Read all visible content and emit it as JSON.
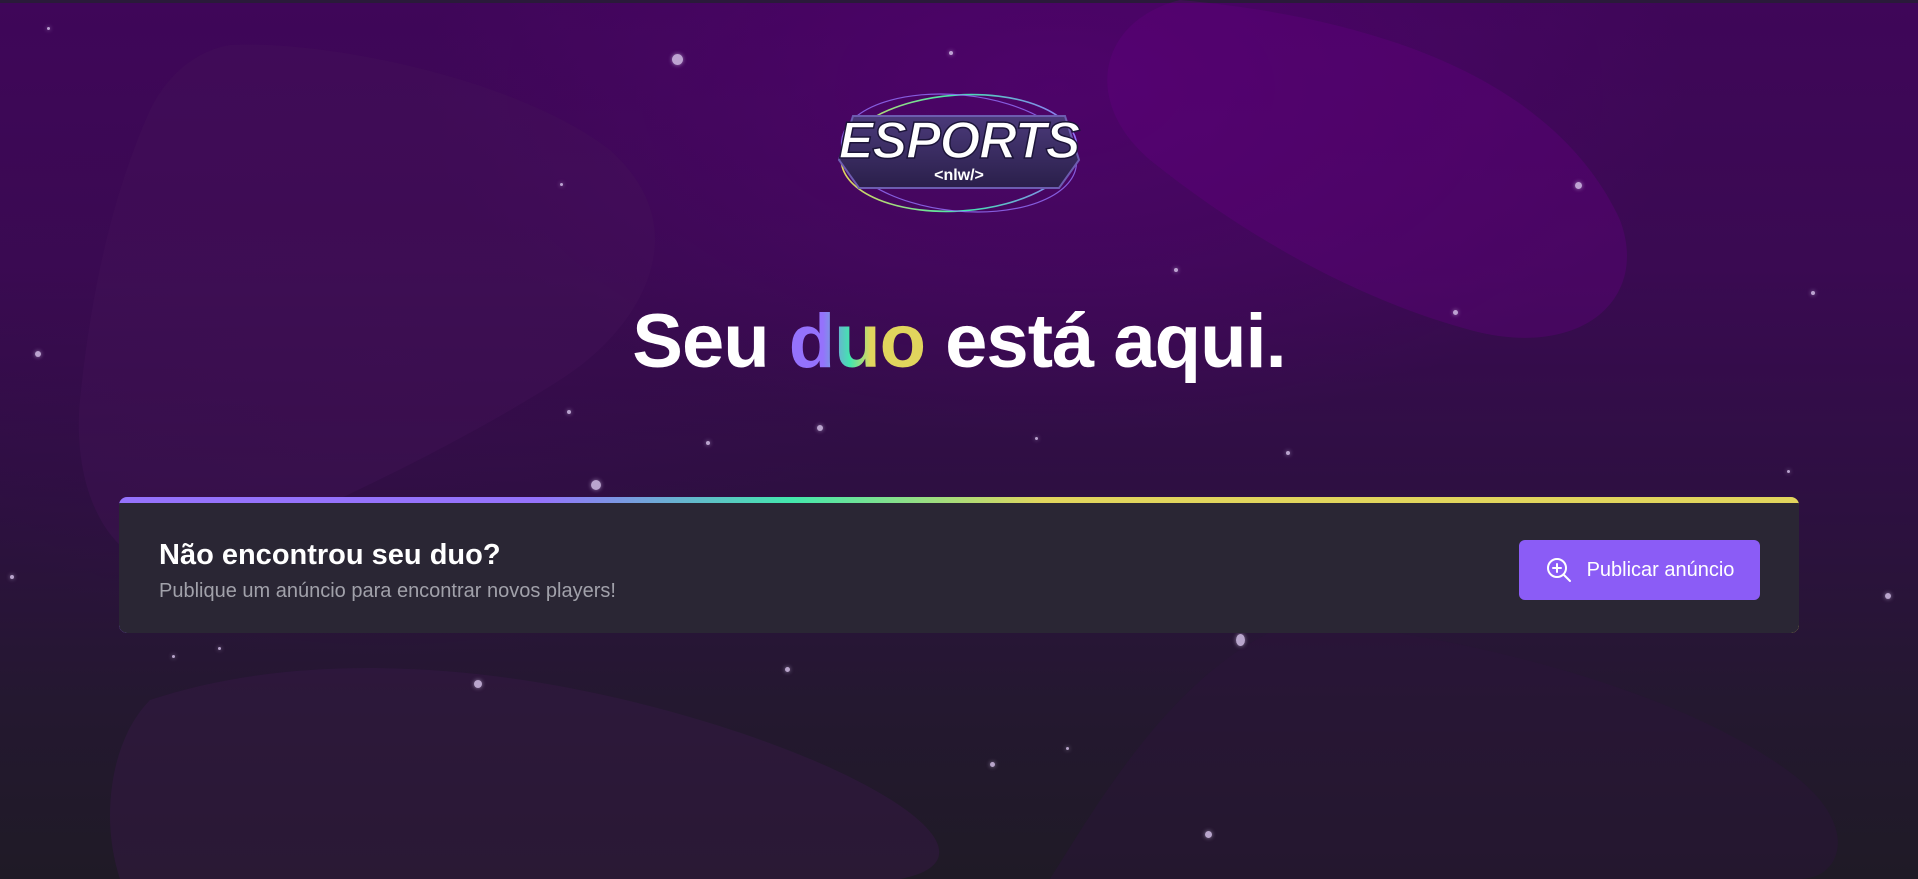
{
  "logo": {
    "wordmark": "ESPORTS",
    "tag": "<nlw/>"
  },
  "headline": {
    "before": "Seu ",
    "accent": "duo",
    "after": " está aqui."
  },
  "banner": {
    "title": "Não encontrou seu duo?",
    "subtitle": "Publique um anúncio para encontrar novos players!",
    "button_label": "Publicar anúncio",
    "button_icon": "magnifying-glass-plus-icon"
  },
  "colors": {
    "accent_purple": "#8b5cf6",
    "gradient_purple": "#9572fc",
    "gradient_green": "#43e7ad",
    "gradient_yellow": "#e1d55d",
    "banner_bg": "#2a2634",
    "subtitle_text": "#a1a1aa"
  }
}
